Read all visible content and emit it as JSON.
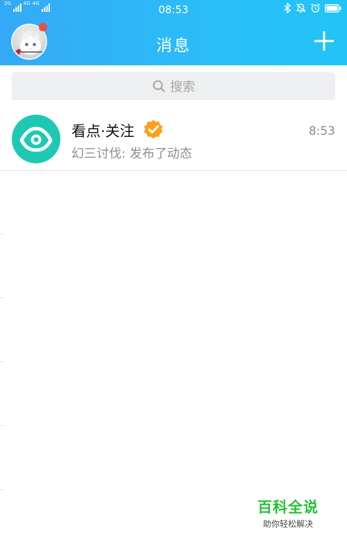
{
  "status_bar": {
    "network_1": "2G",
    "network_2": "4G",
    "network_3": "4G",
    "time": "08:53"
  },
  "header": {
    "title": "消息",
    "avatar_has_badge": true
  },
  "search": {
    "placeholder": "搜索"
  },
  "conversations": [
    {
      "name": "看点·关注",
      "time": "8:53",
      "preview": "幻三讨伐: 发布了动态",
      "verified": true,
      "icon": "eye-icon"
    }
  ],
  "watermark": {
    "title": "百科全说",
    "subtitle": "助你轻松解决"
  },
  "colors": {
    "header_start": "#35a9f7",
    "header_end": "#22c4f8",
    "badge_red": "#f24b3e",
    "conv_icon": "#1ec9b4",
    "verified_orange": "#ff9f1a",
    "watermark_green": "#24c235"
  }
}
